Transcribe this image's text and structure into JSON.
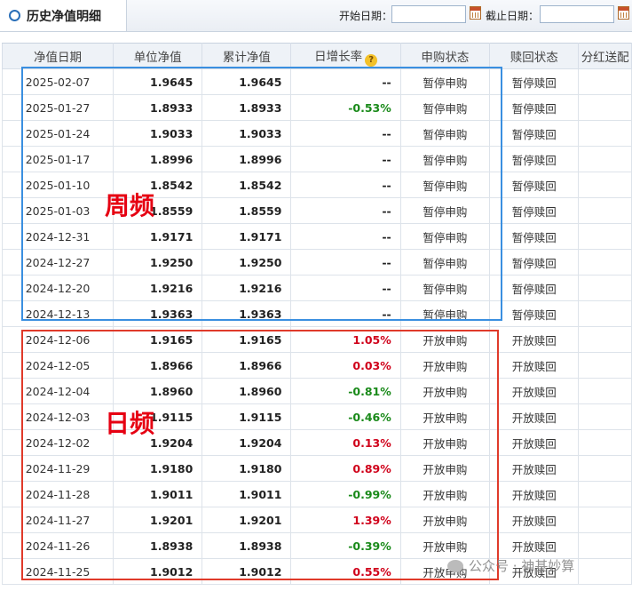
{
  "header": {
    "title": "历史净值明细",
    "start_label": "开始日期：",
    "end_label": "截止日期：",
    "start_value": "",
    "end_value": ""
  },
  "table": {
    "columns": [
      "净值日期",
      "单位净值",
      "累计净值",
      "日增长率",
      "申购状态",
      "赎回状态",
      "分红送配"
    ],
    "rows": [
      {
        "date": "2025-02-07",
        "nav": "1.9645",
        "acc": "1.9645",
        "rate": "--",
        "rate_dir": "flat",
        "sub": "暂停申购",
        "red": "暂停赎回"
      },
      {
        "date": "2025-01-27",
        "nav": "1.8933",
        "acc": "1.8933",
        "rate": "-0.53%",
        "rate_dir": "down",
        "sub": "暂停申购",
        "red": "暂停赎回"
      },
      {
        "date": "2025-01-24",
        "nav": "1.9033",
        "acc": "1.9033",
        "rate": "--",
        "rate_dir": "flat",
        "sub": "暂停申购",
        "red": "暂停赎回"
      },
      {
        "date": "2025-01-17",
        "nav": "1.8996",
        "acc": "1.8996",
        "rate": "--",
        "rate_dir": "flat",
        "sub": "暂停申购",
        "red": "暂停赎回"
      },
      {
        "date": "2025-01-10",
        "nav": "1.8542",
        "acc": "1.8542",
        "rate": "--",
        "rate_dir": "flat",
        "sub": "暂停申购",
        "red": "暂停赎回"
      },
      {
        "date": "2025-01-03",
        "nav": "1.8559",
        "acc": "1.8559",
        "rate": "--",
        "rate_dir": "flat",
        "sub": "暂停申购",
        "red": "暂停赎回"
      },
      {
        "date": "2024-12-31",
        "nav": "1.9171",
        "acc": "1.9171",
        "rate": "--",
        "rate_dir": "flat",
        "sub": "暂停申购",
        "red": "暂停赎回"
      },
      {
        "date": "2024-12-27",
        "nav": "1.9250",
        "acc": "1.9250",
        "rate": "--",
        "rate_dir": "flat",
        "sub": "暂停申购",
        "red": "暂停赎回"
      },
      {
        "date": "2024-12-20",
        "nav": "1.9216",
        "acc": "1.9216",
        "rate": "--",
        "rate_dir": "flat",
        "sub": "暂停申购",
        "red": "暂停赎回"
      },
      {
        "date": "2024-12-13",
        "nav": "1.9363",
        "acc": "1.9363",
        "rate": "--",
        "rate_dir": "flat",
        "sub": "暂停申购",
        "red": "暂停赎回"
      },
      {
        "date": "2024-12-06",
        "nav": "1.9165",
        "acc": "1.9165",
        "rate": "1.05%",
        "rate_dir": "up",
        "sub": "开放申购",
        "red": "开放赎回"
      },
      {
        "date": "2024-12-05",
        "nav": "1.8966",
        "acc": "1.8966",
        "rate": "0.03%",
        "rate_dir": "up",
        "sub": "开放申购",
        "red": "开放赎回"
      },
      {
        "date": "2024-12-04",
        "nav": "1.8960",
        "acc": "1.8960",
        "rate": "-0.81%",
        "rate_dir": "down",
        "sub": "开放申购",
        "red": "开放赎回"
      },
      {
        "date": "2024-12-03",
        "nav": "1.9115",
        "acc": "1.9115",
        "rate": "-0.46%",
        "rate_dir": "down",
        "sub": "开放申购",
        "red": "开放赎回"
      },
      {
        "date": "2024-12-02",
        "nav": "1.9204",
        "acc": "1.9204",
        "rate": "0.13%",
        "rate_dir": "up",
        "sub": "开放申购",
        "red": "开放赎回"
      },
      {
        "date": "2024-11-29",
        "nav": "1.9180",
        "acc": "1.9180",
        "rate": "0.89%",
        "rate_dir": "up",
        "sub": "开放申购",
        "red": "开放赎回"
      },
      {
        "date": "2024-11-28",
        "nav": "1.9011",
        "acc": "1.9011",
        "rate": "-0.99%",
        "rate_dir": "down",
        "sub": "开放申购",
        "red": "开放赎回"
      },
      {
        "date": "2024-11-27",
        "nav": "1.9201",
        "acc": "1.9201",
        "rate": "1.39%",
        "rate_dir": "up",
        "sub": "开放申购",
        "red": "开放赎回"
      },
      {
        "date": "2024-11-26",
        "nav": "1.8938",
        "acc": "1.8938",
        "rate": "-0.39%",
        "rate_dir": "down",
        "sub": "开放申购",
        "red": "开放赎回"
      },
      {
        "date": "2024-11-25",
        "nav": "1.9012",
        "acc": "1.9012",
        "rate": "0.55%",
        "rate_dir": "up",
        "sub": "开放申购",
        "red": "开放赎回"
      }
    ]
  },
  "annotations": {
    "weekly": "周频",
    "daily": "日频",
    "weekly_color": "#3a8fe0",
    "daily_color": "#e03a2a"
  },
  "colors": {
    "up": "#d0021b",
    "down": "#1a8a1a",
    "accent": "#2a6fb8"
  },
  "watermark": "公众号 · 神基妙算"
}
